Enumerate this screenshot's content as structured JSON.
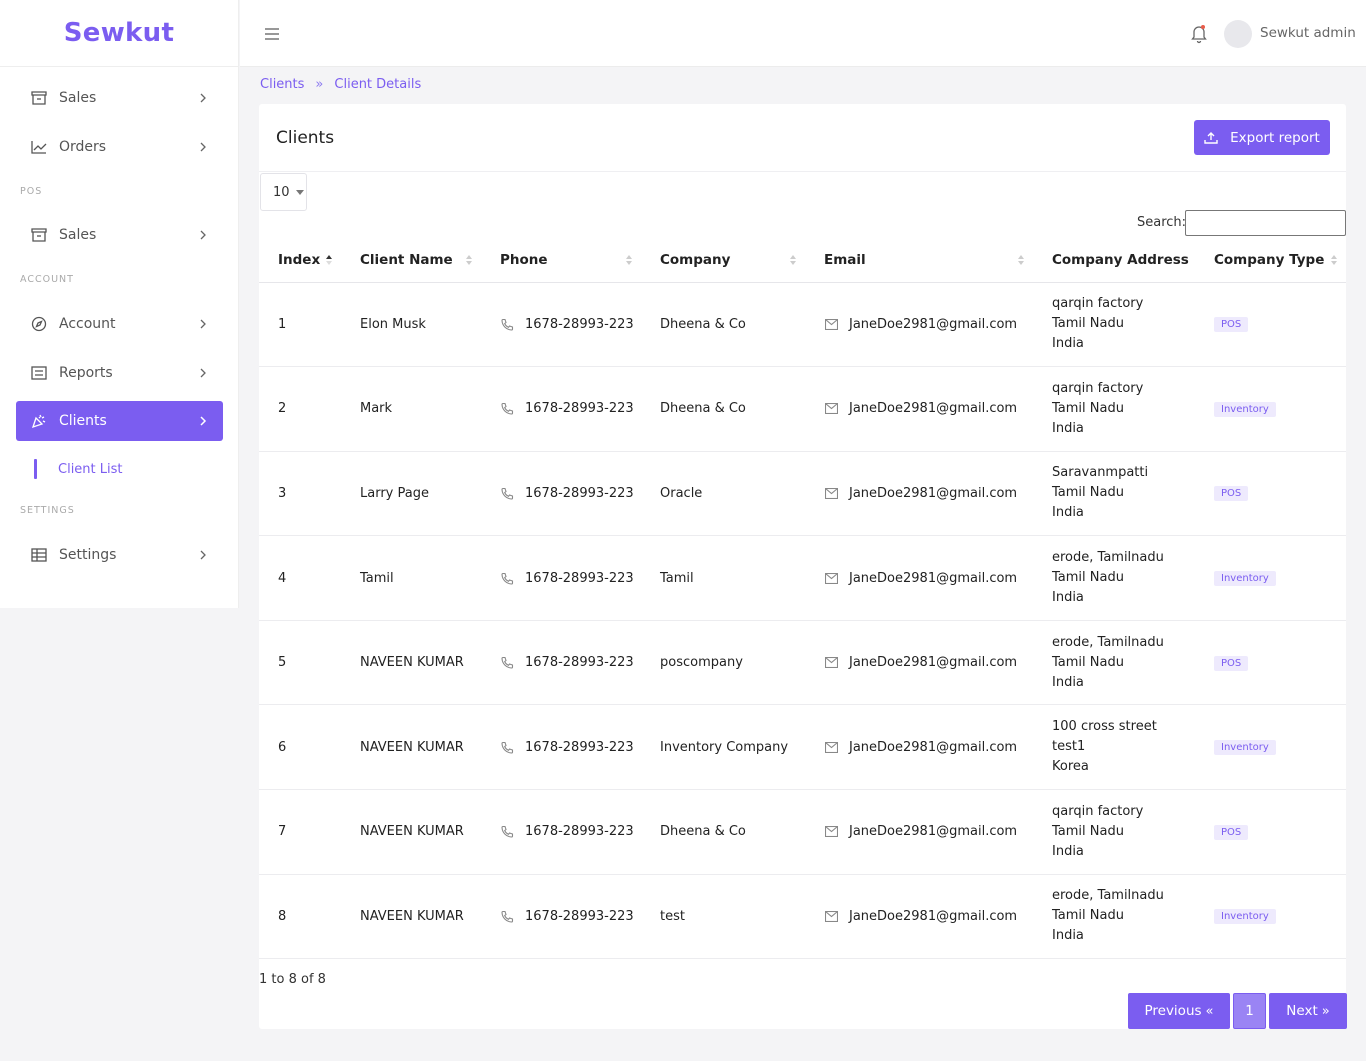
{
  "brand": "Sewkut",
  "header": {
    "user_name": "Sewkut admin"
  },
  "sidebar": {
    "sections": {
      "pos": "POS",
      "account": "ACCOUNT",
      "settings": "SETTINGS"
    },
    "items": {
      "sales": "Sales",
      "orders": "Orders",
      "pos_sales": "Sales",
      "account": "Account",
      "reports": "Reports",
      "clients": "Clients",
      "settings": "Settings"
    },
    "subitem_client_list": "Client List"
  },
  "breadcrumb": {
    "item1": "Clients",
    "item2": "Client Details"
  },
  "card": {
    "title": "Clients",
    "export_label": "Export report"
  },
  "table_controls": {
    "page_length": "10",
    "search_label": "Search:",
    "search_value": ""
  },
  "table": {
    "columns": [
      "Index",
      "Client Name",
      "Phone",
      "Company",
      "Email",
      "Company Address",
      "Company Type"
    ],
    "rows": [
      {
        "index": "1",
        "name": "Elon Musk",
        "phone": "1678-28993-223",
        "company": "Dheena & Co",
        "email": "JaneDoe2981@gmail.com",
        "address": [
          "qarqin factory",
          "Tamil Nadu",
          "India"
        ],
        "type": "POS"
      },
      {
        "index": "2",
        "name": "Mark",
        "phone": "1678-28993-223",
        "company": "Dheena & Co",
        "email": "JaneDoe2981@gmail.com",
        "address": [
          "qarqin factory",
          "Tamil Nadu",
          "India"
        ],
        "type": "Inventory"
      },
      {
        "index": "3",
        "name": "Larry Page",
        "phone": "1678-28993-223",
        "company": "Oracle",
        "email": "JaneDoe2981@gmail.com",
        "address": [
          "Saravanmpatti",
          "Tamil Nadu",
          "India"
        ],
        "type": "POS"
      },
      {
        "index": "4",
        "name": "Tamil",
        "phone": "1678-28993-223",
        "company": "Tamil",
        "email": "JaneDoe2981@gmail.com",
        "address": [
          "erode, Tamilnadu",
          "Tamil Nadu",
          "India"
        ],
        "type": "Inventory"
      },
      {
        "index": "5",
        "name": "NAVEEN KUMAR",
        "phone": "1678-28993-223",
        "company": "poscompany",
        "email": "JaneDoe2981@gmail.com",
        "address": [
          "erode, Tamilnadu",
          "Tamil Nadu",
          "India"
        ],
        "type": "POS"
      },
      {
        "index": "6",
        "name": "NAVEEN KUMAR",
        "phone": "1678-28993-223",
        "company": "Inventory Company",
        "email": "JaneDoe2981@gmail.com",
        "address": [
          "100 cross street",
          "test1",
          "Korea"
        ],
        "type": "Inventory"
      },
      {
        "index": "7",
        "name": "NAVEEN KUMAR",
        "phone": "1678-28993-223",
        "company": "Dheena & Co",
        "email": "JaneDoe2981@gmail.com",
        "address": [
          "qarqin factory",
          "Tamil Nadu",
          "India"
        ],
        "type": "POS"
      },
      {
        "index": "8",
        "name": "NAVEEN KUMAR",
        "phone": "1678-28993-223",
        "company": "test",
        "email": "JaneDoe2981@gmail.com",
        "address": [
          "erode, Tamilnadu",
          "Tamil Nadu",
          "India"
        ],
        "type": "Inventory"
      }
    ]
  },
  "footer": {
    "info": "1 to 8 of 8",
    "prev_label": "Previous",
    "page_number": "1",
    "next_label": "Next"
  },
  "colors": {
    "accent": "#7b5df0",
    "background": "#f4f4f6"
  }
}
